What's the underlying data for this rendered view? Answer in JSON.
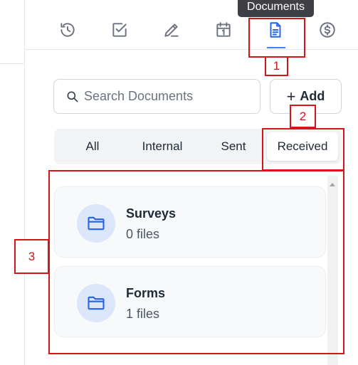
{
  "tooltip": {
    "text": "Documents"
  },
  "tabs": [
    {
      "icon": "history-icon"
    },
    {
      "icon": "checkbox-icon"
    },
    {
      "icon": "pen-icon"
    },
    {
      "icon": "calendar-icon"
    },
    {
      "icon": "document-icon",
      "active": true
    },
    {
      "icon": "dollar-icon"
    }
  ],
  "search": {
    "placeholder": "Search Documents",
    "value": ""
  },
  "add_button": {
    "plus": "+",
    "label": "Add"
  },
  "filters": {
    "all": "All",
    "internal": "Internal",
    "sent": "Sent",
    "received": "Received",
    "selected": "Received"
  },
  "folders": [
    {
      "name": "Surveys",
      "count": "0 files"
    },
    {
      "name": "Forms",
      "count": "1 files"
    }
  ],
  "annotations": {
    "one": "1",
    "two": "2",
    "three": "3"
  },
  "colors": {
    "accent": "#2563eb",
    "annotation": "#d7141a",
    "tooltip_bg": "#3f3f46"
  }
}
